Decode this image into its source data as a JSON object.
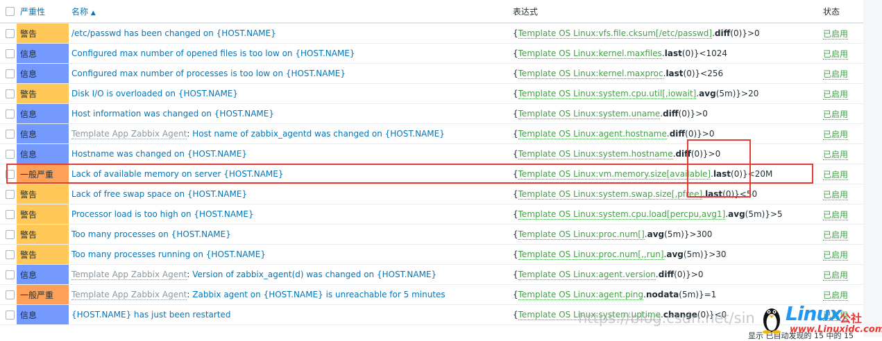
{
  "header": {
    "severity": "严重性",
    "name": "名称",
    "sort_indicator": "▲",
    "expression": "表达式",
    "status": "状态"
  },
  "colors": {
    "warning": "#ffc859",
    "information": "#7499ff",
    "average": "#ffa059",
    "link": "#0275b8",
    "item": "#429e47",
    "highlight": "#e53935"
  },
  "rows": [
    {
      "severity": "警告",
      "sev_key": "warning",
      "template": "",
      "name": "/etc/passwd has been changed on {HOST.NAME}",
      "expr": {
        "pre": "{",
        "item": "Template OS Linux:vfs.file.cksum[/etc/passwd]",
        "dot": ".",
        "fn": "diff",
        "args": "(0)}>0"
      },
      "status": "已启用"
    },
    {
      "severity": "信息",
      "sev_key": "information",
      "template": "",
      "name": "Configured max number of opened files is too low on {HOST.NAME}",
      "expr": {
        "pre": "{",
        "item": "Template OS Linux:kernel.maxfiles",
        "dot": ".",
        "fn": "last",
        "args": "(0)}<1024"
      },
      "status": "已启用"
    },
    {
      "severity": "信息",
      "sev_key": "information",
      "template": "",
      "name": "Configured max number of processes is too low on {HOST.NAME}",
      "expr": {
        "pre": "{",
        "item": "Template OS Linux:kernel.maxproc",
        "dot": ".",
        "fn": "last",
        "args": "(0)}<256"
      },
      "status": "已启用"
    },
    {
      "severity": "警告",
      "sev_key": "warning",
      "template": "",
      "name": "Disk I/O is overloaded on {HOST.NAME}",
      "expr": {
        "pre": "{",
        "item": "Template OS Linux:system.cpu.util[,iowait]",
        "dot": ".",
        "fn": "avg",
        "args": "(5m)}>20"
      },
      "status": "已启用"
    },
    {
      "severity": "信息",
      "sev_key": "information",
      "template": "",
      "name": "Host information was changed on {HOST.NAME}",
      "expr": {
        "pre": "{",
        "item": "Template OS Linux:system.uname",
        "dot": ".",
        "fn": "diff",
        "args": "(0)}>0"
      },
      "status": "已启用"
    },
    {
      "severity": "信息",
      "sev_key": "information",
      "template": "Template App Zabbix Agent",
      "name": "Host name of zabbix_agentd was changed on {HOST.NAME}",
      "expr": {
        "pre": "{",
        "item": "Template OS Linux:agent.hostname",
        "dot": ".",
        "fn": "diff",
        "args": "(0)}>0"
      },
      "status": "已启用"
    },
    {
      "severity": "信息",
      "sev_key": "information",
      "template": "",
      "name": "Hostname was changed on {HOST.NAME}",
      "expr": {
        "pre": "{",
        "item": "Template OS Linux:system.hostname",
        "dot": ".",
        "fn": "diff",
        "args": "(0)}>0"
      },
      "status": "已启用"
    },
    {
      "severity": "一般严重",
      "sev_key": "average",
      "template": "",
      "name": "Lack of available memory on server {HOST.NAME}",
      "expr": {
        "pre": "{",
        "item": "Template OS Linux:vm.memory.size[available]",
        "dot": ".",
        "fn": "last",
        "args": "(0)}<20M"
      },
      "status": "已启用"
    },
    {
      "severity": "警告",
      "sev_key": "warning",
      "template": "",
      "name": "Lack of free swap space on {HOST.NAME}",
      "expr": {
        "pre": "{",
        "item": "Template OS Linux:system.swap.size[,pfree]",
        "dot": ".",
        "fn": "last",
        "args": "(0)}<50"
      },
      "status": "已启用"
    },
    {
      "severity": "警告",
      "sev_key": "warning",
      "template": "",
      "name": "Processor load is too high on {HOST.NAME}",
      "expr": {
        "pre": "{",
        "item": "Template OS Linux:system.cpu.load[percpu,avg1]",
        "dot": ".",
        "fn": "avg",
        "args": "(5m)}>5"
      },
      "status": "已启用"
    },
    {
      "severity": "警告",
      "sev_key": "warning",
      "template": "",
      "name": "Too many processes on {HOST.NAME}",
      "expr": {
        "pre": "{",
        "item": "Template OS Linux:proc.num[]",
        "dot": ".",
        "fn": "avg",
        "args": "(5m)}>300"
      },
      "status": "已启用"
    },
    {
      "severity": "警告",
      "sev_key": "warning",
      "template": "",
      "name": "Too many processes running on {HOST.NAME}",
      "expr": {
        "pre": "{",
        "item": "Template OS Linux:proc.num[,,run]",
        "dot": ".",
        "fn": "avg",
        "args": "(5m)}>30"
      },
      "status": "已启用"
    },
    {
      "severity": "信息",
      "sev_key": "information",
      "template": "Template App Zabbix Agent",
      "name": "Version of zabbix_agent(d) was changed on {HOST.NAME}",
      "expr": {
        "pre": "{",
        "item": "Template OS Linux:agent.version",
        "dot": ".",
        "fn": "diff",
        "args": "(0)}>0"
      },
      "status": "已启用"
    },
    {
      "severity": "一般严重",
      "sev_key": "average",
      "template": "Template App Zabbix Agent",
      "name": "Zabbix agent on {HOST.NAME} is unreachable for 5 minutes",
      "expr": {
        "pre": "{",
        "item": "Template OS Linux:agent.ping",
        "dot": ".",
        "fn": "nodata",
        "args": "(5m)}=1"
      },
      "status": "已启用"
    },
    {
      "severity": "信息",
      "sev_key": "information",
      "template": "",
      "name": "{HOST.NAME} has just been restarted",
      "expr": {
        "pre": "{",
        "item": "Template OS Linux:system.uptime",
        "dot": ".",
        "fn": "change",
        "args": "(0)}<0"
      },
      "status": "已启用"
    }
  ],
  "watermark": {
    "url": "https://blog.csdn.net/sin",
    "logo_text": "Linux",
    "logo_cn": "公社",
    "logo_url": "www.Linuxidc.com",
    "footer": "显示 已自动发现的 15 中的 15"
  }
}
